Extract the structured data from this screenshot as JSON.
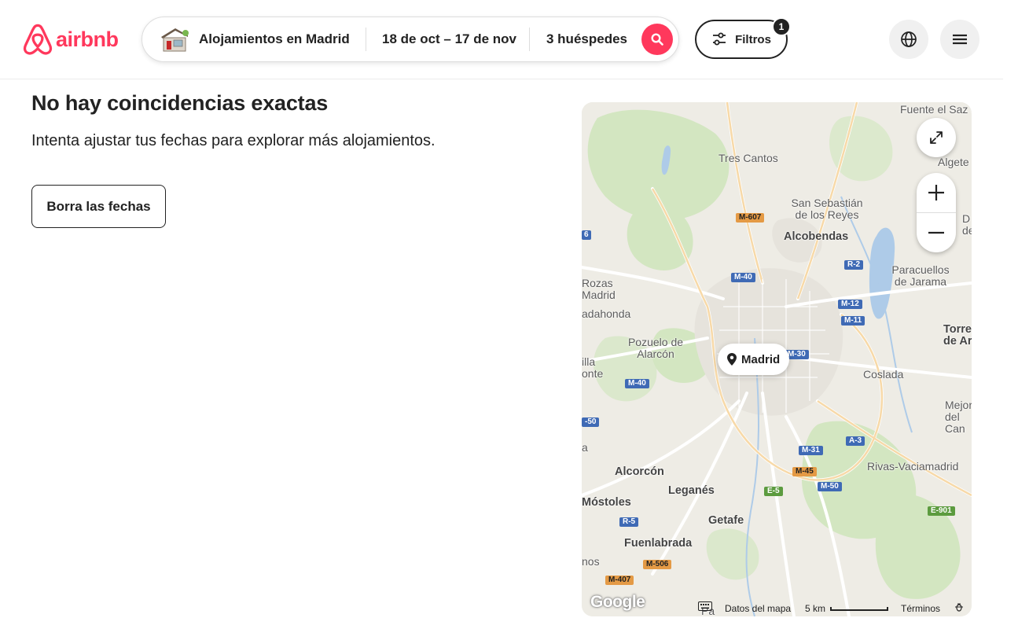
{
  "header": {
    "brand": "airbnb",
    "search": {
      "location": "Alojamientos en Madrid",
      "dates": "18 de oct – 17 de nov",
      "guests": "3 huéspedes"
    },
    "filters": {
      "label": "Filtros",
      "count": "1"
    }
  },
  "results": {
    "title": "No hay coincidencias exactas",
    "subtitle": "Intenta ajustar tus fechas para explorar más alojamientos.",
    "clear_button": "Borra las fechas"
  },
  "map": {
    "pin": "Madrid",
    "places": {
      "fuente_el_saz": "Fuente el Saz de Jarama",
      "algete": "Algete",
      "tres_cantos": "Tres Cantos",
      "san_sebastian": "San Sebastián de los Reyes",
      "alcobendas": "Alcobendas",
      "las_rozas": "Rozas Madrid",
      "majadahonda": "adahonda",
      "paracuellos": "Paracuellos de Jarama",
      "torrejon": "Torre de Ar",
      "daganzo": "D de",
      "pozuelo": "Pozuelo de Alarcón",
      "boadilla": "illa onte",
      "coslada": "Coslada",
      "mejorada": "Mejora del Can",
      "villaviciosa": "a",
      "alcorcon": "Alcorcón",
      "leganes": "Leganés",
      "rivas": "Rivas-Vaciamadrid",
      "mostoles": "Móstoles",
      "getafe": "Getafe",
      "fuenlabrada": "Fuenlabrada",
      "humanes": "nos",
      "parla": "Pa"
    },
    "roads": {
      "m607": "M-607",
      "m40a": "M-40",
      "r2": "R-2",
      "m12": "M-12",
      "m11": "M-11",
      "m30": "M-30",
      "m40b": "M-40",
      "m50a": "-50",
      "a3": "A-3",
      "m31": "M-31",
      "m45": "M-45",
      "e5": "E-5",
      "m50b": "M-50",
      "e901": "E-901",
      "r5": "R-5",
      "m506": "M-506",
      "m407": "M-407",
      "m6": "6"
    },
    "footer": {
      "google": "Google",
      "map_data": "Datos del mapa",
      "scale": "5 km",
      "terms": "Términos"
    }
  },
  "colors": {
    "brand": "#ff385c",
    "map_bg": "#eeece5",
    "park": "#cfe6bd",
    "water": "#aecbe8"
  }
}
